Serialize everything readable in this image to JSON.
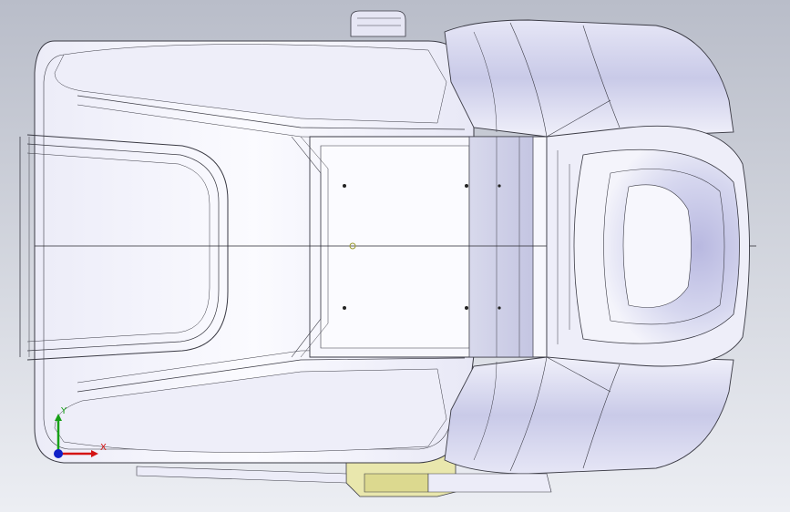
{
  "viewport": {
    "background_top": "#b9bdc9",
    "background_bottom": "#eceef3"
  },
  "model": {
    "name": "",
    "shell_color": "#f4f4fb",
    "shade_color": "#d5d6ee",
    "edge_color": "#3a3a44",
    "accent_part_color": "#e8e6a8"
  },
  "triad": {
    "x_label": "X",
    "y_label": "Y",
    "x_color": "#d41414",
    "y_color": "#16a016",
    "origin_color": "#1020c8"
  }
}
